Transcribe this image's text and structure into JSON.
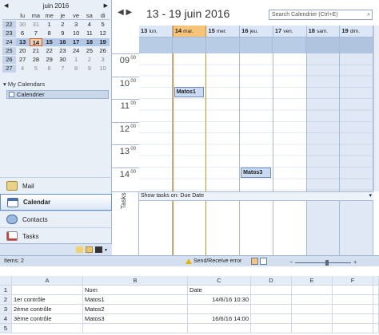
{
  "minical": {
    "month": "juin 2016",
    "dow": [
      "",
      "lu",
      "ma",
      "me",
      "je",
      "ve",
      "sa",
      "di"
    ],
    "weeks": [
      {
        "wk": "22",
        "days": [
          "30",
          "31",
          "1",
          "2",
          "3",
          "4",
          "5"
        ]
      },
      {
        "wk": "23",
        "days": [
          "6",
          "7",
          "8",
          "9",
          "10",
          "11",
          "12"
        ]
      },
      {
        "wk": "24",
        "days": [
          "13",
          "14",
          "15",
          "16",
          "17",
          "18",
          "19"
        ]
      },
      {
        "wk": "25",
        "days": [
          "20",
          "21",
          "22",
          "23",
          "24",
          "25",
          "26"
        ]
      },
      {
        "wk": "26",
        "days": [
          "27",
          "28",
          "29",
          "30",
          "1",
          "2",
          "3"
        ]
      },
      {
        "wk": "27",
        "days": [
          "4",
          "5",
          "6",
          "7",
          "8",
          "9",
          "10"
        ]
      }
    ]
  },
  "mycalendars": {
    "header": "My Calendars",
    "item": "Calendrier"
  },
  "nav": {
    "mail": "Mail",
    "calendar": "Calendar",
    "contacts": "Contacts",
    "tasks": "Tasks"
  },
  "calendar": {
    "date_range": "13 - 19 juin 2016",
    "search_placeholder": "Search Calendrier (Ctrl+E)",
    "days": [
      {
        "num": "13",
        "name": "lun."
      },
      {
        "num": "14",
        "name": "mar."
      },
      {
        "num": "15",
        "name": "mer."
      },
      {
        "num": "16",
        "name": "jeu."
      },
      {
        "num": "17",
        "name": "ven."
      },
      {
        "num": "18",
        "name": "sam."
      },
      {
        "num": "19",
        "name": "dim."
      }
    ],
    "hours": [
      "09",
      "10",
      "11",
      "12",
      "13",
      "14"
    ],
    "hour_suffix": "00",
    "appointments": [
      {
        "label": "Matos1"
      },
      {
        "label": "Matos3"
      }
    ],
    "tasks_bar": "Show tasks on: Due Date",
    "tasks_label": "Tasks"
  },
  "status": {
    "items": "Items: 2",
    "error": "Send/Receive error"
  },
  "sheet": {
    "columns": [
      "",
      "A",
      "B",
      "C",
      "D",
      "E",
      "F",
      ""
    ],
    "rows": [
      {
        "n": "1",
        "A": "",
        "B": "Nom",
        "C": "Date"
      },
      {
        "n": "2",
        "A": "1er contrôle",
        "B": "Matos1",
        "C": "14/6/16 10:30"
      },
      {
        "n": "3",
        "A": "2ème contrôle",
        "B": "Matos2",
        "C": ""
      },
      {
        "n": "4",
        "A": "3ème contrôle",
        "B": "Matos3",
        "C": "16/6/16 14:00"
      },
      {
        "n": "5",
        "A": "",
        "B": "",
        "C": ""
      }
    ]
  }
}
